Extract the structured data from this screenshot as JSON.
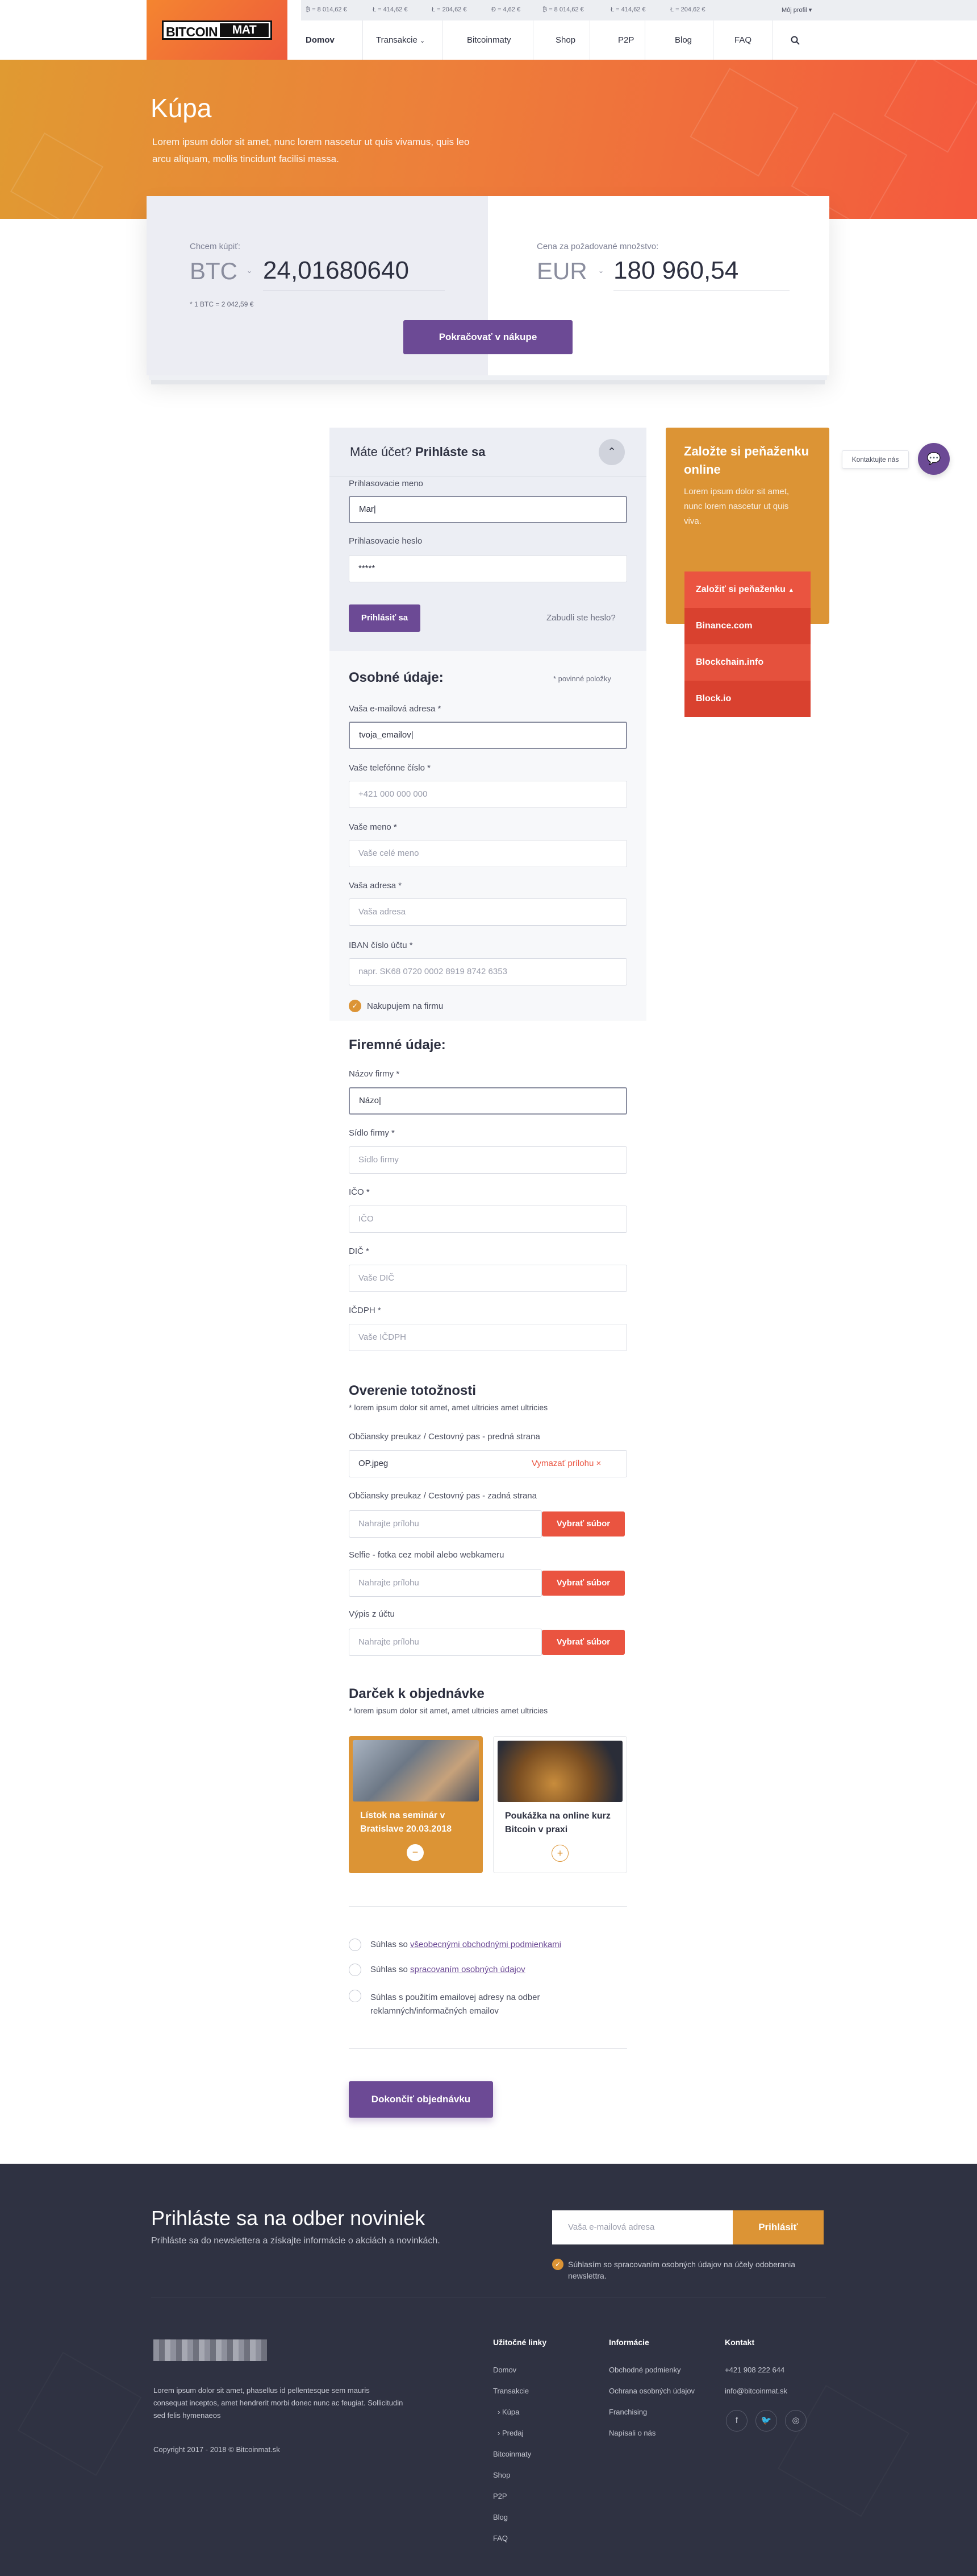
{
  "ticker": [
    "₿ = 8 014,62 €",
    "Ł = 414,62 €",
    "Ł = 204,62 €",
    "Đ = 4,62 €",
    "₿ = 8 014,62 €",
    "Ł = 414,62 €",
    "Ł = 204,62 €"
  ],
  "profile": "Môj profil",
  "logo": {
    "part1": "BITCOIN",
    "part2": "MAT"
  },
  "nav": [
    "Domov",
    "Transakcie",
    "Bitcoinmaty",
    "Shop",
    "P2P",
    "Blog",
    "FAQ"
  ],
  "hero": {
    "title": "Kúpa",
    "text": "Lorem ipsum dolor sit amet, nunc lorem nascetur ut quis vivamus, quis leo arcu aliquam, mollis tincidunt facilisi massa."
  },
  "calc": {
    "buy_label": "Chcem kúpiť:",
    "buy_currency": "BTC",
    "buy_value": "24,01680640",
    "rate": "* 1 BTC = 2 042,59 €",
    "price_label": "Cena za požadované množstvo:",
    "price_currency": "EUR",
    "price_value": "180 960,54",
    "continue": "Pokračovať v nákupe"
  },
  "login": {
    "title_a": "Máte účet?",
    "title_b": "Prihláste sa",
    "user_label": "Prihlasovacie meno",
    "user_value": "Mar|",
    "pass_label": "Prihlasovacie heslo",
    "pass_value": "*****",
    "submit": "Prihlásiť sa",
    "forgot": "Zabudli ste heslo?"
  },
  "wallet": {
    "title": "Založte si peňaženku online",
    "text": "Lorem ipsum dolor sit amet, nunc lorem nascetur ut quis viva.",
    "dropdown": "Založiť si peňaženku",
    "options": [
      "Binance.com",
      "Blockchain.info",
      "Block.io"
    ]
  },
  "contact": "Kontaktujte nás",
  "personal": {
    "title": "Osobné údaje:",
    "required": "* povinné položky",
    "fields": [
      {
        "label": "Vaša e-mailová adresa *",
        "value": "tvoja_emailov|",
        "placeholder": ""
      },
      {
        "label": "Vaše telefónne číslo *",
        "value": "",
        "placeholder": "+421 000 000 000"
      },
      {
        "label": "Vaše meno *",
        "value": "",
        "placeholder": "Vaše celé meno"
      },
      {
        "label": "Vaša adresa *",
        "value": "",
        "placeholder": "Vaša adresa"
      },
      {
        "label": "IBAN číslo účtu *",
        "value": "",
        "placeholder": "napr. SK68 0720 0002 8919 8742 6353"
      }
    ],
    "company_check": "Nakupujem na firmu"
  },
  "company": {
    "title": "Firemné údaje:",
    "fields": [
      {
        "label": "Názov firmy *",
        "value": "Názo|",
        "placeholder": ""
      },
      {
        "label": "Sídlo firmy *",
        "value": "",
        "placeholder": "Sídlo firmy"
      },
      {
        "label": "IČO *",
        "value": "",
        "placeholder": "IČO"
      },
      {
        "label": "DIČ *",
        "value": "",
        "placeholder": "Vaše DIČ"
      },
      {
        "label": "IČDPH *",
        "value": "",
        "placeholder": "Vaše IČDPH"
      }
    ]
  },
  "verify": {
    "title": "Overenie totožnosti",
    "note": "* lorem ipsum dolor sit amet, amet ultricies amet ultricies",
    "uploads": [
      {
        "label": "Občiansky preukaz / Cestovný pas - predná strana",
        "value": "OP.jpeg",
        "action": "Vymazať prílohu ×"
      },
      {
        "label": "Občiansky preukaz / Cestovný pas - zadná strana",
        "placeholder": "Nahrajte prílohu",
        "action": "Vybrať súbor"
      },
      {
        "label": "Selfie - fotka cez mobil alebo webkameru",
        "placeholder": "Nahrajte prílohu",
        "action": "Vybrať súbor"
      },
      {
        "label": "Výpis z účtu",
        "placeholder": "Nahrajte prílohu",
        "action": "Vybrať súbor"
      }
    ]
  },
  "gift": {
    "title": "Darček k objednávke",
    "note": "* lorem ipsum dolor sit amet, amet ultricies amet ultricies",
    "items": [
      {
        "text": "Lístok na seminár v Bratislave 20.03.2018",
        "icon": "−"
      },
      {
        "text": "Poukážka na online kurz Bitcoin v praxi",
        "icon": "+"
      }
    ]
  },
  "consents": [
    {
      "pre": "Súhlas so ",
      "link": "všeobecnými obchodnými podmienkami"
    },
    {
      "pre": "Súhlas so ",
      "link": "spracovaním osobných údajov"
    },
    {
      "pre": "Súhlas s použitím emailovej adresy na odber reklamných/informačných emailov",
      "link": ""
    }
  ],
  "finish": "Dokončiť objednávku",
  "newsletter": {
    "title": "Prihláste sa na odber noviniek",
    "text": "Prihláste sa do newslettera a získajte informácie o  akciách a novinkách.",
    "placeholder": "Vaša e-mailová adresa",
    "button": "Prihlásiť",
    "consent": "Súhlasím so spracovaním osobných údajov na účely odoberania newslettra."
  },
  "footer": {
    "about": "Lorem ipsum dolor sit amet, phasellus id pellentesque sem mauris consequat inceptos, amet hendrerit morbi donec nunc ac feugiat. Sollicitudin sed felis hymenaeos",
    "copyright": "Copyright 2017 - 2018 © Bitcoinmat.sk",
    "col1": {
      "title": "Užitočné linky",
      "items": [
        "Domov",
        "Transakcie",
        "› Kúpa",
        "› Predaj",
        "Bitcoinmaty",
        "Shop",
        "P2P",
        "Blog",
        "FAQ"
      ]
    },
    "col2": {
      "title": "Informácie",
      "items": [
        "Obchodné podmienky",
        "Ochrana osobných údajov",
        "Franchising",
        "Napísali o nás"
      ]
    },
    "col3": {
      "title": "Kontakt",
      "items": [
        "+421 908 222 644",
        "info@bitcoinmat.sk"
      ]
    }
  },
  "colors": {
    "accent": "#6c4a95",
    "orange": "#dc9435",
    "red": "#ea5440",
    "footer": "#2f3242"
  }
}
